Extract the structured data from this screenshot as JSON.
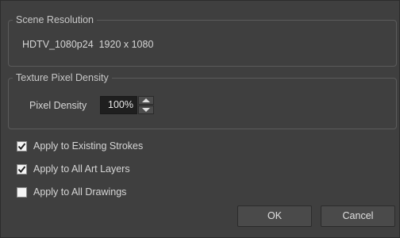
{
  "scene_resolution": {
    "legend": "Scene Resolution",
    "value": "HDTV_1080p24  1920 x 1080"
  },
  "texture_pixel_density": {
    "legend": "Texture Pixel Density",
    "label": "Pixel Density",
    "value": "100%"
  },
  "options": [
    {
      "label": "Apply to Existing Strokes",
      "checked": true
    },
    {
      "label": "Apply to All Art Layers",
      "checked": true
    },
    {
      "label": "Apply to All Drawings",
      "checked": false
    }
  ],
  "buttons": {
    "ok": "OK",
    "cancel": "Cancel"
  },
  "icons": {
    "spin_up": "arrow-up-icon",
    "spin_down": "arrow-down-icon",
    "check": "checkmark-icon"
  }
}
